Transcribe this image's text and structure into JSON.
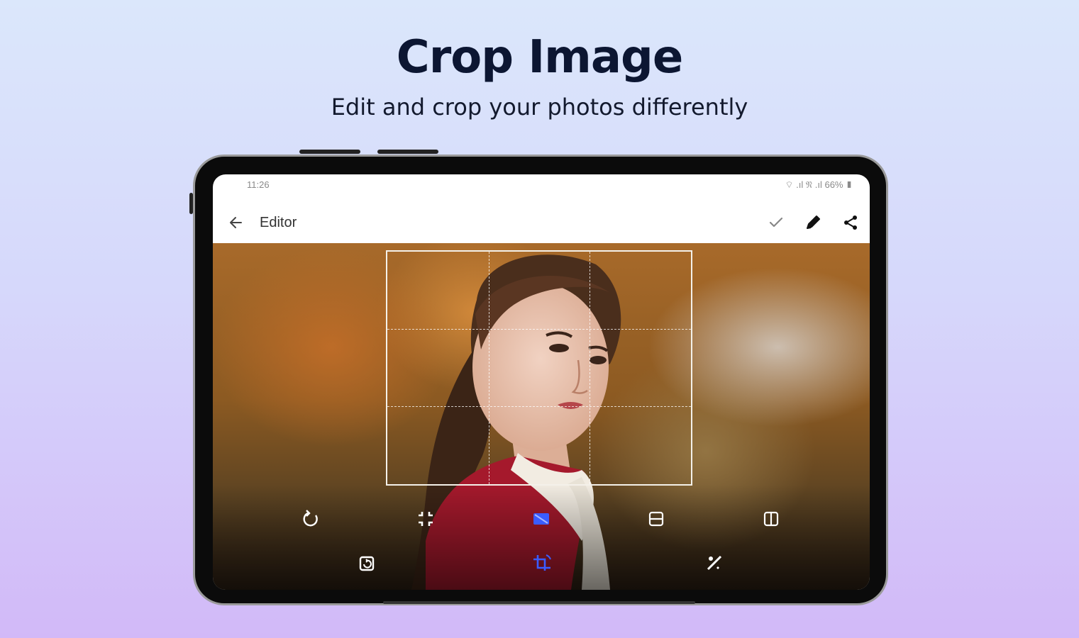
{
  "promo": {
    "title": "Crop Image",
    "subtitle": "Edit and crop your photos differently"
  },
  "status_bar": {
    "time": "11:26",
    "icons_text": "⌔ .ıl 𝔑 .ıl 66% ▮"
  },
  "app_bar": {
    "title": "Editor",
    "back_icon": "arrow-left-icon",
    "actions": [
      "check-icon",
      "pencil-icon",
      "share-icon"
    ]
  },
  "crop_tools": {
    "row1": [
      "rotate-icon",
      "fit-icon",
      "aspect-ratio-icon",
      "flip-vertical-icon",
      "flip-horizontal-icon"
    ],
    "row2": [
      "rotate-image-icon",
      "crop-rotate-icon",
      "straighten-icon"
    ],
    "active": [
      "aspect-ratio-icon",
      "crop-rotate-icon"
    ]
  },
  "colors": {
    "title": "#0c1632",
    "accent_active": "#3a5cff",
    "icon_default": "#ffffff",
    "app_text": "#333333"
  }
}
